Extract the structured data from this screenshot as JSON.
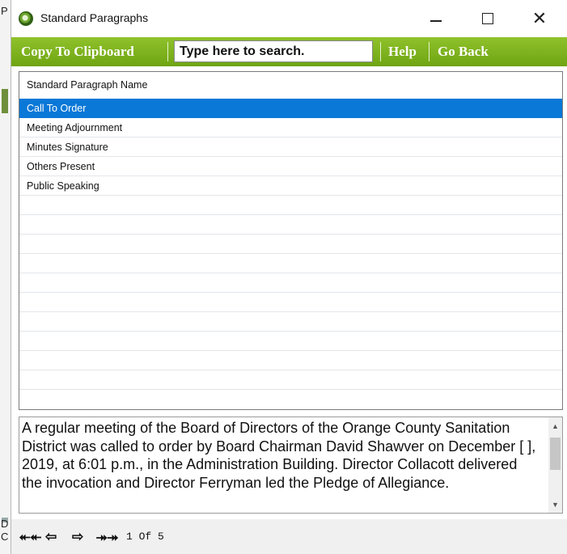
{
  "window": {
    "title": "Standard Paragraphs"
  },
  "toolbar": {
    "copy_label": "Copy To Clipboard",
    "search_placeholder": "Type here to search.",
    "search_value": "",
    "help_label": "Help",
    "back_label": "Go Back"
  },
  "list": {
    "header": "Standard Paragraph Name",
    "items": [
      {
        "label": "Call To Order",
        "selected": true
      },
      {
        "label": "Meeting Adjournment"
      },
      {
        "label": "Minutes Signature"
      },
      {
        "label": "Others Present"
      },
      {
        "label": "Public Speaking"
      }
    ],
    "empty_rows": 10
  },
  "preview": {
    "text": "A regular meeting of the Board of Directors of the Orange County Sanitation District was called to order by Board Chairman David Shawver on December [ ], 2019, at 6:01 p.m., in the Administration Building. Director Collacott delivered the invocation and Director Ferryman led the Pledge of Allegiance."
  },
  "navigator": {
    "page_indicator": "1 Of 5"
  },
  "background_fragments": {
    "a": "P",
    "b": "D",
    "c": "C"
  },
  "colors": {
    "toolbar": "#7db31d",
    "selection": "#0a78d7"
  }
}
